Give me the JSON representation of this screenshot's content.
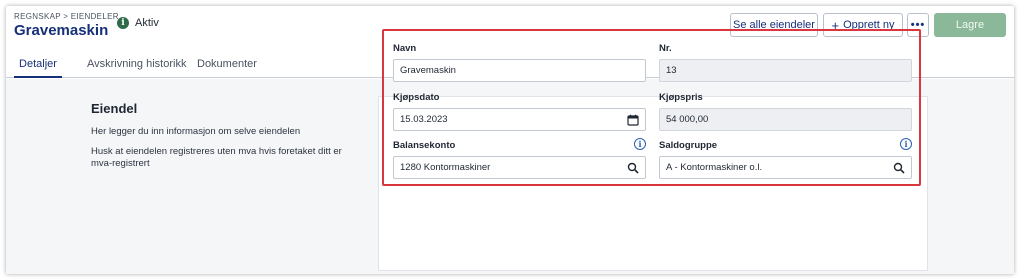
{
  "header": {
    "breadcrumb": "REGNSKAP > EIENDELER",
    "title": "Gravemaskin",
    "status": "Aktiv"
  },
  "actions": {
    "see_all": "Se alle eiendeler",
    "create_new": "Opprett ny",
    "more": "•••",
    "save": "Lagre"
  },
  "tabs": [
    "Detaljer",
    "Avskrivning historikk",
    "Dokumenter"
  ],
  "section": {
    "title": "Eiendel",
    "text1": "Her legger du inn informasjon om selve eiendelen",
    "text2": "Husk at eiendelen registreres uten mva hvis foretaket ditt er mva-registrert"
  },
  "form": {
    "navn": {
      "label": "Navn",
      "value": "Gravemaskin"
    },
    "nr": {
      "label": "Nr.",
      "value": "13"
    },
    "kjopsdato": {
      "label": "Kjøpsdato",
      "value": "15.03.2023"
    },
    "kjopspris": {
      "label": "Kjøpspris",
      "value": "54 000,00"
    },
    "balansekonto": {
      "label": "Balansekonto",
      "value": "1280 Kontormaskiner"
    },
    "saldogruppe": {
      "label": "Saldogruppe",
      "value": "A - Kontormaskiner o.l."
    }
  },
  "colors": {
    "primary": "#17307a",
    "save_button": "#8ab898",
    "status_icon": "#2e6b4a",
    "highlight": "#d9363e"
  },
  "icons": {
    "status": "info-circle-icon",
    "calendar": "calendar-icon",
    "search": "search-icon",
    "info": "info-icon"
  }
}
